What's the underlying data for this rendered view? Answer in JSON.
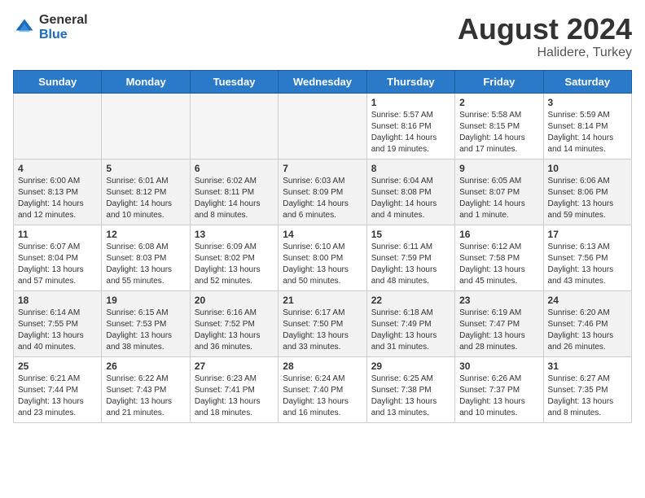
{
  "header": {
    "logo_general": "General",
    "logo_blue": "Blue",
    "month_year": "August 2024",
    "location": "Halidere, Turkey"
  },
  "weekdays": [
    "Sunday",
    "Monday",
    "Tuesday",
    "Wednesday",
    "Thursday",
    "Friday",
    "Saturday"
  ],
  "weeks": [
    [
      {
        "day": "",
        "info": ""
      },
      {
        "day": "",
        "info": ""
      },
      {
        "day": "",
        "info": ""
      },
      {
        "day": "",
        "info": ""
      },
      {
        "day": "1",
        "info": "Sunrise: 5:57 AM\nSunset: 8:16 PM\nDaylight: 14 hours\nand 19 minutes."
      },
      {
        "day": "2",
        "info": "Sunrise: 5:58 AM\nSunset: 8:15 PM\nDaylight: 14 hours\nand 17 minutes."
      },
      {
        "day": "3",
        "info": "Sunrise: 5:59 AM\nSunset: 8:14 PM\nDaylight: 14 hours\nand 14 minutes."
      }
    ],
    [
      {
        "day": "4",
        "info": "Sunrise: 6:00 AM\nSunset: 8:13 PM\nDaylight: 14 hours\nand 12 minutes."
      },
      {
        "day": "5",
        "info": "Sunrise: 6:01 AM\nSunset: 8:12 PM\nDaylight: 14 hours\nand 10 minutes."
      },
      {
        "day": "6",
        "info": "Sunrise: 6:02 AM\nSunset: 8:11 PM\nDaylight: 14 hours\nand 8 minutes."
      },
      {
        "day": "7",
        "info": "Sunrise: 6:03 AM\nSunset: 8:09 PM\nDaylight: 14 hours\nand 6 minutes."
      },
      {
        "day": "8",
        "info": "Sunrise: 6:04 AM\nSunset: 8:08 PM\nDaylight: 14 hours\nand 4 minutes."
      },
      {
        "day": "9",
        "info": "Sunrise: 6:05 AM\nSunset: 8:07 PM\nDaylight: 14 hours\nand 1 minute."
      },
      {
        "day": "10",
        "info": "Sunrise: 6:06 AM\nSunset: 8:06 PM\nDaylight: 13 hours\nand 59 minutes."
      }
    ],
    [
      {
        "day": "11",
        "info": "Sunrise: 6:07 AM\nSunset: 8:04 PM\nDaylight: 13 hours\nand 57 minutes."
      },
      {
        "day": "12",
        "info": "Sunrise: 6:08 AM\nSunset: 8:03 PM\nDaylight: 13 hours\nand 55 minutes."
      },
      {
        "day": "13",
        "info": "Sunrise: 6:09 AM\nSunset: 8:02 PM\nDaylight: 13 hours\nand 52 minutes."
      },
      {
        "day": "14",
        "info": "Sunrise: 6:10 AM\nSunset: 8:00 PM\nDaylight: 13 hours\nand 50 minutes."
      },
      {
        "day": "15",
        "info": "Sunrise: 6:11 AM\nSunset: 7:59 PM\nDaylight: 13 hours\nand 48 minutes."
      },
      {
        "day": "16",
        "info": "Sunrise: 6:12 AM\nSunset: 7:58 PM\nDaylight: 13 hours\nand 45 minutes."
      },
      {
        "day": "17",
        "info": "Sunrise: 6:13 AM\nSunset: 7:56 PM\nDaylight: 13 hours\nand 43 minutes."
      }
    ],
    [
      {
        "day": "18",
        "info": "Sunrise: 6:14 AM\nSunset: 7:55 PM\nDaylight: 13 hours\nand 40 minutes."
      },
      {
        "day": "19",
        "info": "Sunrise: 6:15 AM\nSunset: 7:53 PM\nDaylight: 13 hours\nand 38 minutes."
      },
      {
        "day": "20",
        "info": "Sunrise: 6:16 AM\nSunset: 7:52 PM\nDaylight: 13 hours\nand 36 minutes."
      },
      {
        "day": "21",
        "info": "Sunrise: 6:17 AM\nSunset: 7:50 PM\nDaylight: 13 hours\nand 33 minutes."
      },
      {
        "day": "22",
        "info": "Sunrise: 6:18 AM\nSunset: 7:49 PM\nDaylight: 13 hours\nand 31 minutes."
      },
      {
        "day": "23",
        "info": "Sunrise: 6:19 AM\nSunset: 7:47 PM\nDaylight: 13 hours\nand 28 minutes."
      },
      {
        "day": "24",
        "info": "Sunrise: 6:20 AM\nSunset: 7:46 PM\nDaylight: 13 hours\nand 26 minutes."
      }
    ],
    [
      {
        "day": "25",
        "info": "Sunrise: 6:21 AM\nSunset: 7:44 PM\nDaylight: 13 hours\nand 23 minutes."
      },
      {
        "day": "26",
        "info": "Sunrise: 6:22 AM\nSunset: 7:43 PM\nDaylight: 13 hours\nand 21 minutes."
      },
      {
        "day": "27",
        "info": "Sunrise: 6:23 AM\nSunset: 7:41 PM\nDaylight: 13 hours\nand 18 minutes."
      },
      {
        "day": "28",
        "info": "Sunrise: 6:24 AM\nSunset: 7:40 PM\nDaylight: 13 hours\nand 16 minutes."
      },
      {
        "day": "29",
        "info": "Sunrise: 6:25 AM\nSunset: 7:38 PM\nDaylight: 13 hours\nand 13 minutes."
      },
      {
        "day": "30",
        "info": "Sunrise: 6:26 AM\nSunset: 7:37 PM\nDaylight: 13 hours\nand 10 minutes."
      },
      {
        "day": "31",
        "info": "Sunrise: 6:27 AM\nSunset: 7:35 PM\nDaylight: 13 hours\nand 8 minutes."
      }
    ]
  ]
}
